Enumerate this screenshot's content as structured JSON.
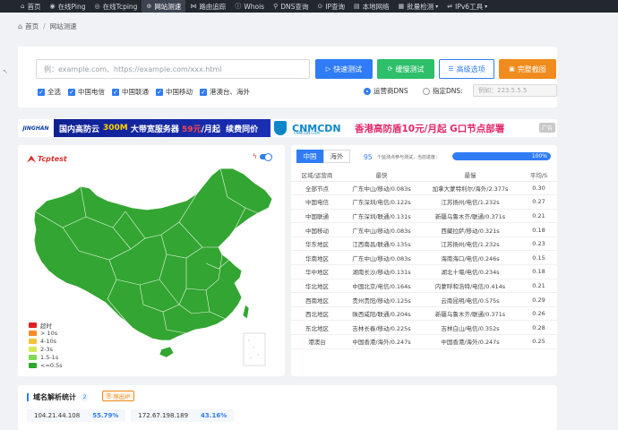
{
  "nav": {
    "items": [
      {
        "icon": "⌂",
        "label": "首页"
      },
      {
        "icon": "◉",
        "label": "在线Ping"
      },
      {
        "icon": "◎",
        "label": "在线Tcping"
      },
      {
        "icon": "⊕",
        "label": "网站测速"
      },
      {
        "icon": "⋈",
        "label": "路由追踪"
      },
      {
        "icon": "ⓘ",
        "label": "Whois"
      },
      {
        "icon": "⚲",
        "label": "DNS查询"
      },
      {
        "icon": "⊙",
        "label": "IP查询"
      },
      {
        "icon": "▤",
        "label": "本地网络"
      },
      {
        "icon": "▦",
        "label": "批量检测"
      },
      {
        "icon": "⇌",
        "label": "IPv6工具"
      }
    ]
  },
  "breadcrumb": {
    "home": "首页",
    "current": "网站测速"
  },
  "search": {
    "placeholder": "例：example.com、https://example.com/xxx.html",
    "buttons": {
      "fast": "快速测试",
      "slow": "缓慢测试",
      "advanced": "高级选项",
      "screenshot": "完整截图"
    },
    "checks": [
      "全选",
      "中国电信",
      "中国联通",
      "中国移动",
      "港澳台、海外"
    ],
    "dns_isp": "运营商DNS",
    "dns_custom": "指定DNS:",
    "dns_placeholder": "例如：223.5.5.5"
  },
  "banner": {
    "logo": "JINGHAN",
    "text_a": "国内高防云",
    "text_b": "300M",
    "text_c": " 大带宽服务器 ",
    "text_d": "59元",
    "text_e": "/月起  续费同价",
    "brand": "CNMCDN",
    "brand_sub": "CNMCDN.COM",
    "promo": "香港高防盾10元/月起 G口节点部署",
    "tag": "广告"
  },
  "map": {
    "logo": "Tcptest",
    "legend": [
      {
        "label": "超时",
        "color": "#e02020"
      },
      {
        "label": "> 10s",
        "color": "#f28c28"
      },
      {
        "label": "4-10s",
        "color": "#f6c23e"
      },
      {
        "label": "2-3s",
        "color": "#d8e85a"
      },
      {
        "label": "1.5-1s",
        "color": "#7fd957"
      },
      {
        "label": "<=0.5s",
        "color": "#2ea72a"
      }
    ],
    "map_color": "#33a532"
  },
  "results": {
    "tabs": [
      "中国",
      "海外"
    ],
    "count": "95",
    "status": "个监测点参与测试，当前进度：",
    "progress_pct": 100,
    "progress_label": "100%",
    "headers": [
      "区域/运营商",
      "最快",
      "最慢",
      "平均/S"
    ],
    "rows": [
      [
        "全部节点",
        "广东中山/移动/0.083s",
        "加拿大蒙特利尔/海外/2.377s",
        "0.30"
      ],
      [
        "中国电信",
        "广东深圳/电信/0.122s",
        "江苏扬州/电信/1.232s",
        "0.27"
      ],
      [
        "中国联通",
        "广东深圳/联通/0.131s",
        "新疆乌鲁木齐/联通/0.371s",
        "0.21"
      ],
      [
        "中国移动",
        "广东中山/移动/0.083s",
        "西藏拉萨/移动/0.321s",
        "0.18"
      ],
      [
        "华东地区",
        "江西南昌/联通/0.135s",
        "江苏扬州/电信/1.232s",
        "0.23"
      ],
      [
        "华南地区",
        "广东中山/移动/0.083s",
        "海南海口/电信/0.246s",
        "0.15"
      ],
      [
        "华中地区",
        "湖南长沙/移动/0.131s",
        "湖北十堰/电信/0.234s",
        "0.18"
      ],
      [
        "华北地区",
        "中国北京/电信/0.164s",
        "内蒙呼和浩特/电信/0.414s",
        "0.21"
      ],
      [
        "西南地区",
        "贵州贵阳/移动/0.125s",
        "云南昆明/电信/0.575s",
        "0.29"
      ],
      [
        "西北地区",
        "陕西咸阳/联通/0.204s",
        "新疆乌鲁木齐/联通/0.371s",
        "0.26"
      ],
      [
        "东北地区",
        "吉林长春/移动/0.225s",
        "吉林白山/电信/0.352s",
        "0.28"
      ],
      [
        "港澳台",
        "中国香港/海外/0.247s",
        "中国香港/海外/0.247s",
        "0.25"
      ]
    ]
  },
  "dns_stats": {
    "title": "域名解析统计",
    "count": "2",
    "export": "导出IP",
    "ips": [
      {
        "ip": "104.21.44.108",
        "pct": "55.79%"
      },
      {
        "ip": "172.67.198.189",
        "pct": "43.16%"
      }
    ]
  }
}
